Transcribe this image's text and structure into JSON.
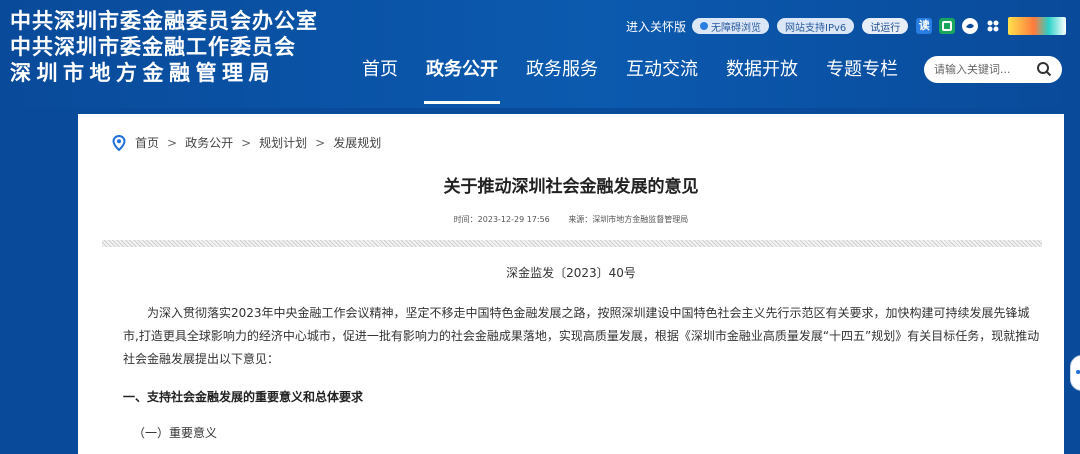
{
  "header": {
    "org_lines": [
      "中共深圳市委金融委员会办公室",
      "中共深圳市委金融工作委员会",
      "深圳市地方金融管理局"
    ],
    "care_mode": "进入关怀版",
    "accessibility_pill": "无障碍浏览",
    "ipv6_pill": "网站支持IPv6",
    "trial_pill": "试运行",
    "icons": [
      "du-icon",
      "wechat-icon",
      "weibo-icon",
      "app-icon",
      "shenzhen-logo"
    ]
  },
  "nav": {
    "items": [
      {
        "label": "首页",
        "active": false
      },
      {
        "label": "政务公开",
        "active": true
      },
      {
        "label": "政务服务",
        "active": false
      },
      {
        "label": "互动交流",
        "active": false
      },
      {
        "label": "数据开放",
        "active": false
      },
      {
        "label": "专题专栏",
        "active": false
      }
    ]
  },
  "search": {
    "placeholder": "请输入关键词..."
  },
  "breadcrumb": [
    "首页",
    "政务公开",
    "规划计划",
    "发展规划"
  ],
  "article": {
    "title": "关于推动深圳社会金融发展的意见",
    "time": "时间：2023-12-29 17:56",
    "source": "来源：深圳市地方金融监督管理局",
    "doc_number": "深金监发〔2023〕40号",
    "intro": "为深入贯彻落实2023年中央金融工作会议精神，坚定不移走中国特色金融发展之路，按照深圳建设中国特色社会主义先行示范区有关要求，加快构建可持续发展先锋城市,打造更具全球影响力的经济中心城市，促进一批有影响力的社会金融成果落地，实现高质量发展，根据《深圳市金融业高质量发展“十四五”规划》有关目标任务，现就推动社会金融发展提出以下意见：",
    "section1": "一、支持社会金融发展的重要意义和总体要求",
    "subsection1": "（一）重要意义"
  },
  "colors": {
    "brand_blue": "#0a4a9a",
    "panel_bg": "#ffffff",
    "text": "#333333"
  }
}
